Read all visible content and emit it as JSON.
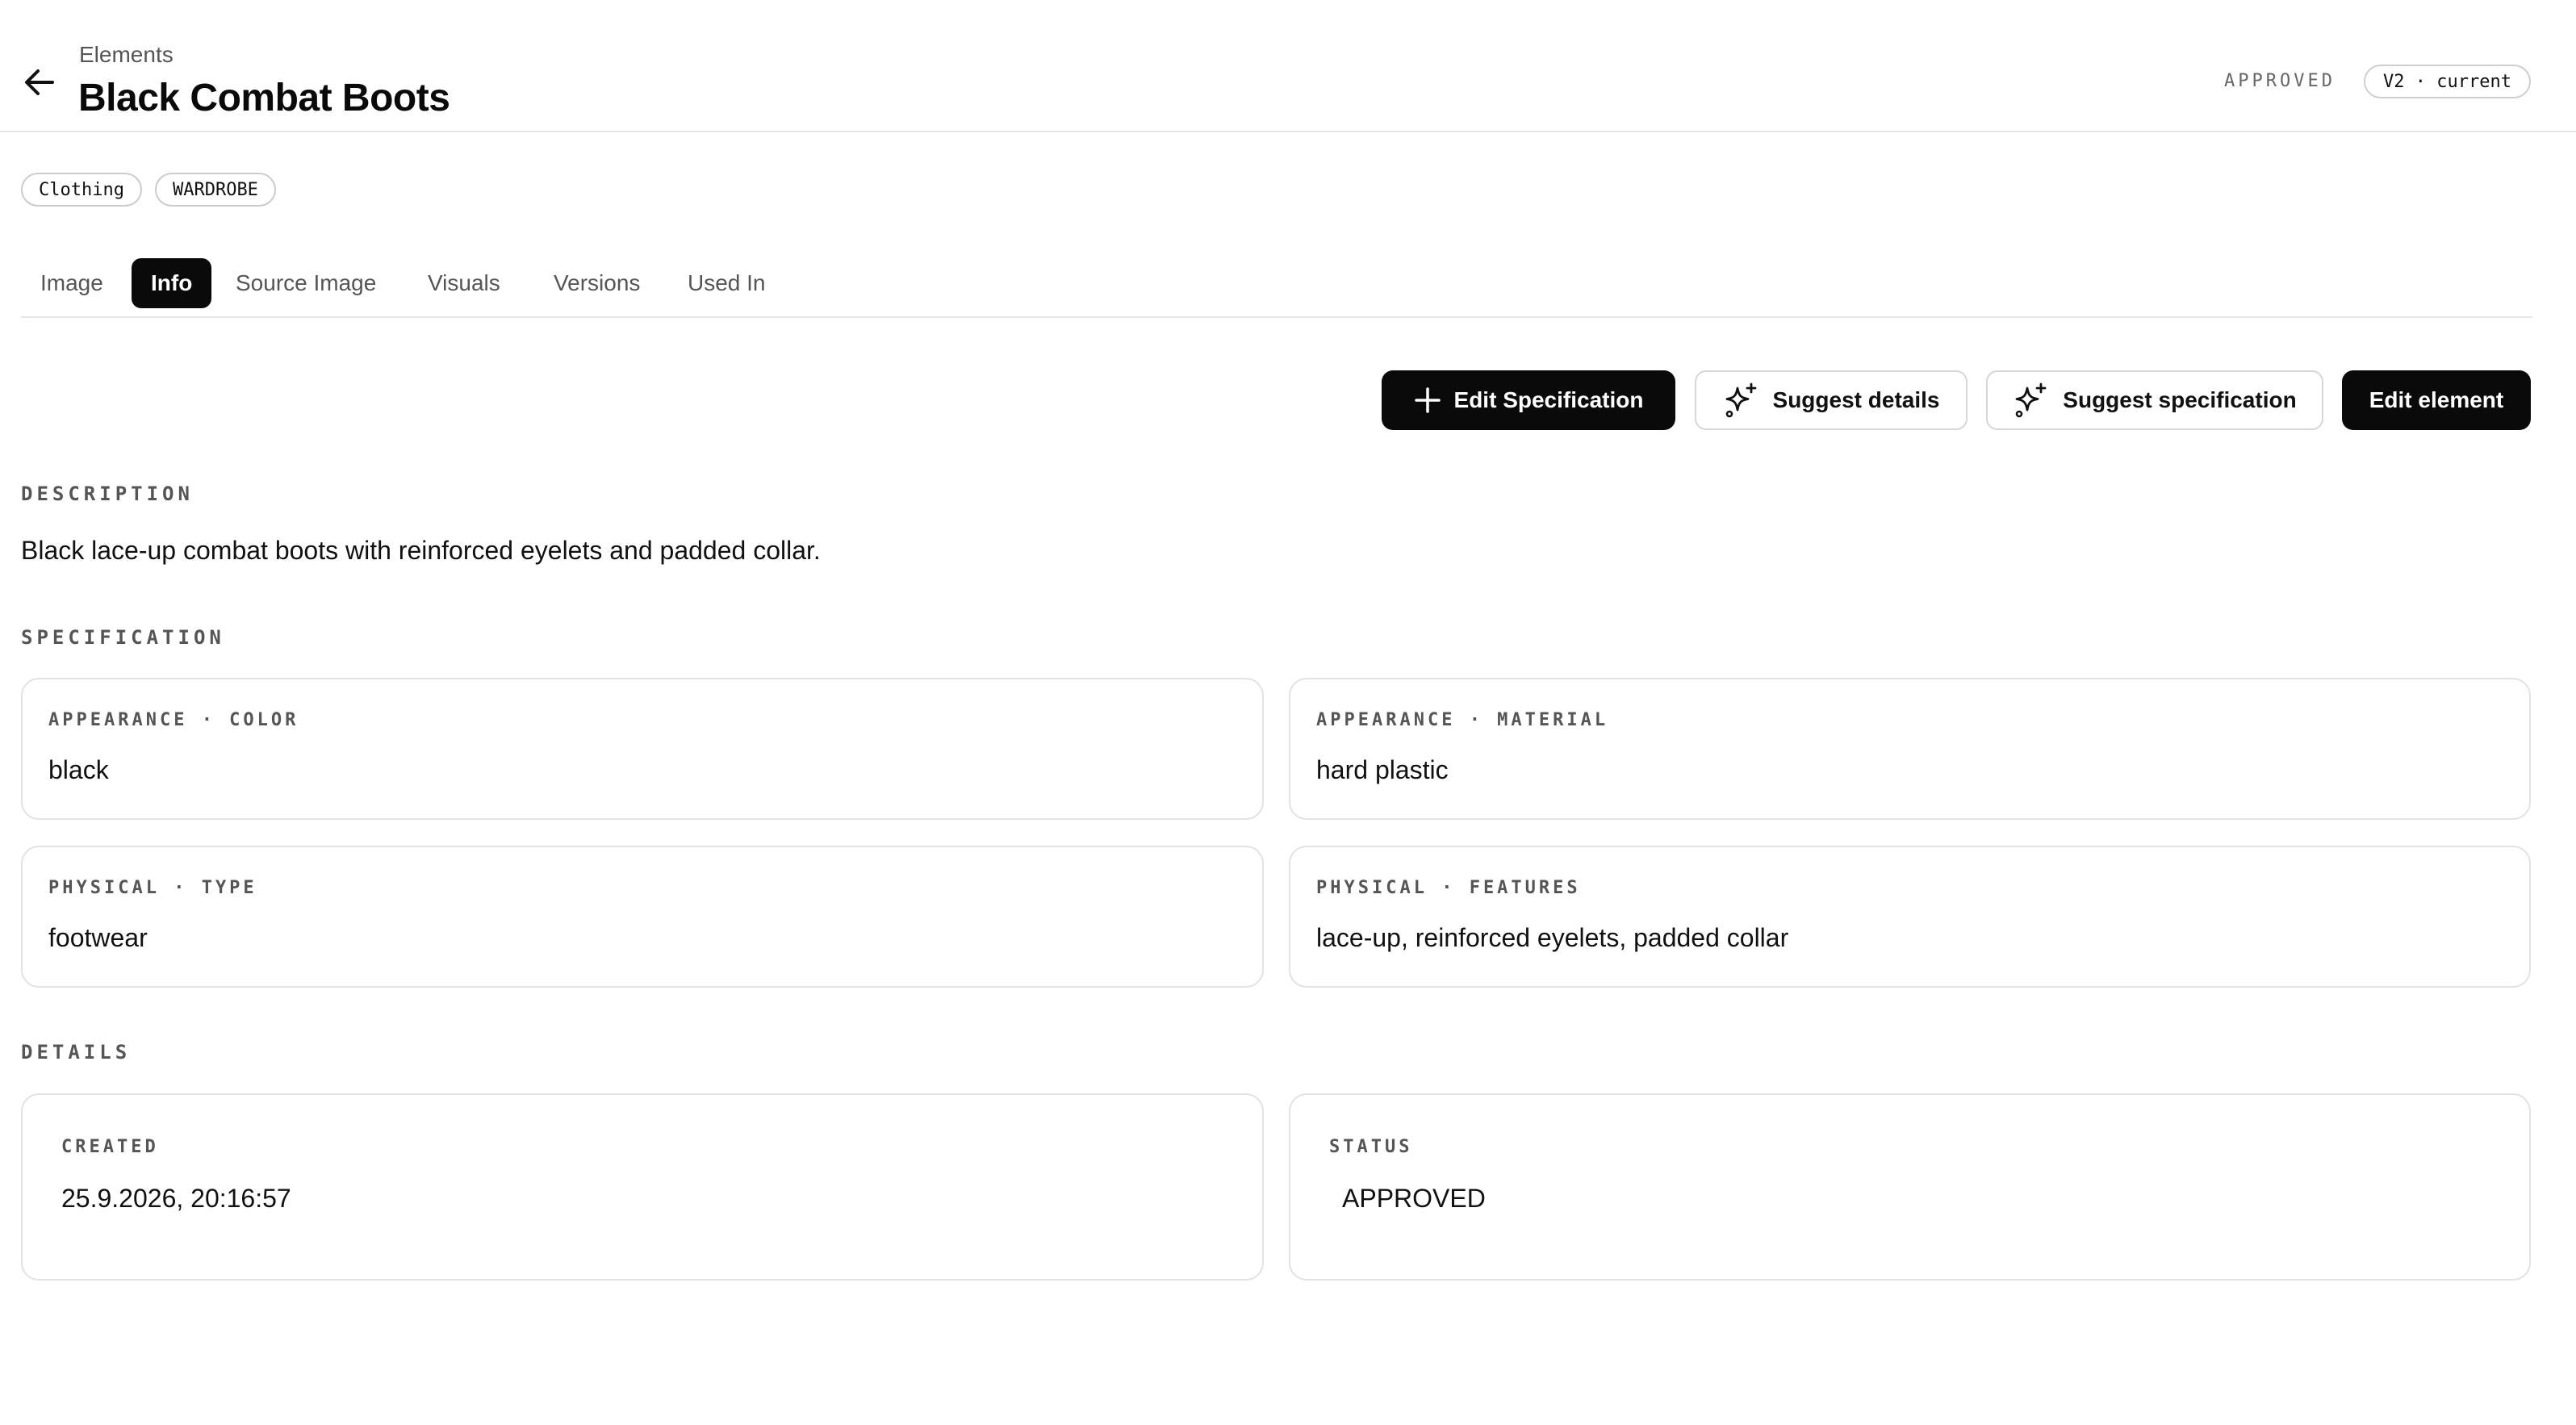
{
  "header": {
    "breadcrumb": "Elements",
    "title": "Black Combat Boots",
    "status": "APPROVED",
    "version": "V2 · current"
  },
  "tags": [
    "Clothing",
    "WARDROBE"
  ],
  "tabs": [
    {
      "label": "Image",
      "active": false
    },
    {
      "label": "Info",
      "active": true
    },
    {
      "label": "Source Image",
      "active": false
    },
    {
      "label": "Visuals",
      "active": false
    },
    {
      "label": "Versions",
      "active": false
    },
    {
      "label": "Used In",
      "active": false
    }
  ],
  "actions": {
    "edit_specification": "Edit Specification",
    "suggest_details": "Suggest details",
    "suggest_specification": "Suggest specification",
    "edit_element": "Edit element"
  },
  "description": {
    "heading": "DESCRIPTION",
    "text": "Black lace-up combat boots with reinforced eyelets and padded collar."
  },
  "specification": {
    "heading": "SPECIFICATION",
    "items": [
      {
        "label": "APPEARANCE · COLOR",
        "value": "black"
      },
      {
        "label": "APPEARANCE · MATERIAL",
        "value": "hard plastic"
      },
      {
        "label": "PHYSICAL · TYPE",
        "value": "footwear"
      },
      {
        "label": "PHYSICAL · FEATURES",
        "value": "lace-up, reinforced eyelets, padded collar"
      }
    ]
  },
  "details": {
    "heading": "DETAILS",
    "created_label": "CREATED",
    "created_value": "25.9.2026, 20:16:57",
    "status_label": "STATUS",
    "status_value": "APPROVED"
  },
  "icons": {
    "back": "arrow-left-icon",
    "plus": "plus-icon",
    "sparkles": "sparkles-icon"
  }
}
